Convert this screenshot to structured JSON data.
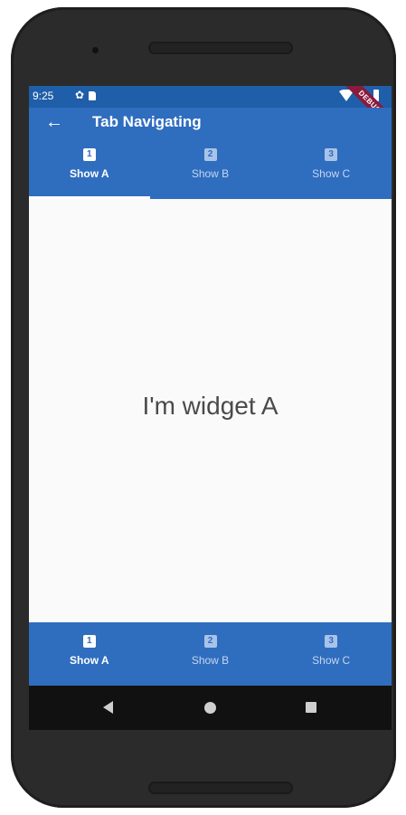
{
  "status_bar": {
    "time": "9:25",
    "debug_label": "DEBUG"
  },
  "app_bar": {
    "title": "Tab Navigating",
    "back_icon": "arrow-back-icon"
  },
  "top_tabs": [
    {
      "icon_number": "1",
      "label": "Show A",
      "active": true
    },
    {
      "icon_number": "2",
      "label": "Show B",
      "active": false
    },
    {
      "icon_number": "3",
      "label": "Show C",
      "active": false
    }
  ],
  "content": {
    "text": "I'm widget A"
  },
  "bottom_tabs": [
    {
      "icon_number": "1",
      "label": "Show A",
      "active": true
    },
    {
      "icon_number": "2",
      "label": "Show B",
      "active": false
    },
    {
      "icon_number": "3",
      "label": "Show C",
      "active": false
    }
  ],
  "nav_bar": {
    "back": "back-triangle-icon",
    "home": "home-circle-icon",
    "recents": "recents-square-icon"
  },
  "colors": {
    "primary": "#2f6dbf",
    "status_bar": "#1f5ea8",
    "background": "#fafafa",
    "debug_banner": "#8b1a3c"
  }
}
